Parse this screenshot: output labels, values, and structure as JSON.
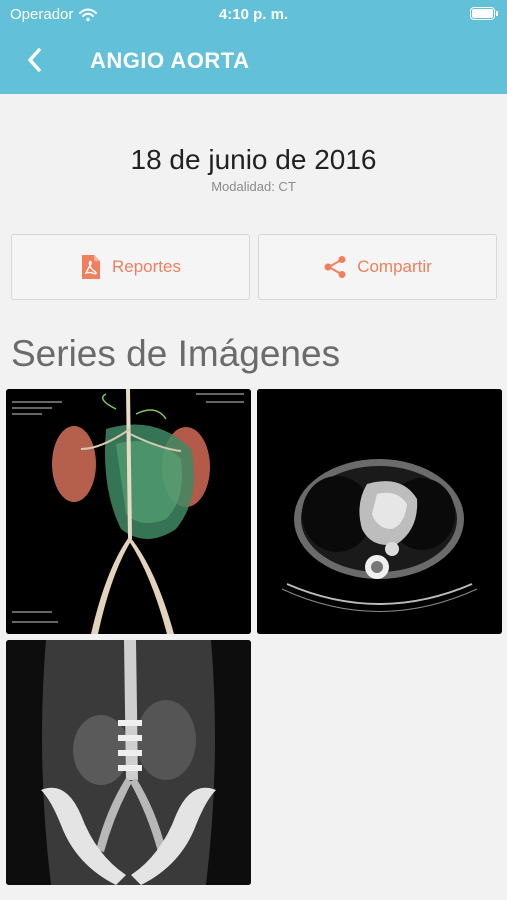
{
  "status_bar": {
    "carrier": "Operador",
    "time": "4:10 p. m.",
    "icons": [
      "wifi-icon",
      "battery-icon"
    ]
  },
  "nav": {
    "title": "ANGIO AORTA",
    "back_icon": "chevron-left-icon"
  },
  "study": {
    "date": "18 de junio de 2016",
    "modality": "Modalidad: CT"
  },
  "actions": {
    "reportes": {
      "label": "Reportes",
      "icon": "pdf-icon"
    },
    "compartir": {
      "label": "Compartir",
      "icon": "share-icon"
    }
  },
  "series": {
    "heading": "Series de Imágenes",
    "items": [
      {
        "name": "3d-volume-render"
      },
      {
        "name": "axial-ct-slice"
      },
      {
        "name": "coronal-ct-slice"
      }
    ]
  },
  "colors": {
    "header": "#62c0d8",
    "accent": "#ef7f5d",
    "background": "#f2f2f2"
  }
}
